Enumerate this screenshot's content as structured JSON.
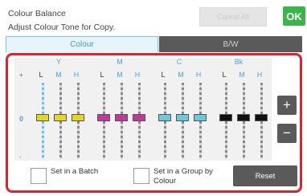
{
  "header": {
    "title": "Colour Balance",
    "subtitle": "Adjust Colour Tone for Copy.",
    "cancel_all_label": "Cancel All",
    "ok_label": "OK"
  },
  "tabs": [
    {
      "label": "Colour",
      "active": true
    },
    {
      "label": "B/W",
      "active": false
    }
  ],
  "scale": {
    "plus": "+",
    "zero": "0",
    "minus": "-"
  },
  "groups": [
    {
      "name": "Y",
      "color": "#e6d521",
      "columns": [
        "L",
        "M",
        "H"
      ],
      "levels": [
        0,
        0,
        0
      ]
    },
    {
      "name": "M",
      "color": "#c0399a",
      "columns": [
        "L",
        "M",
        "H"
      ],
      "levels": [
        0,
        0,
        0
      ]
    },
    {
      "name": "C",
      "color": "#6ac9df",
      "columns": [
        "L",
        "M",
        "H"
      ],
      "levels": [
        0,
        0,
        0
      ]
    },
    {
      "name": "Bk",
      "color": "#111111",
      "columns": [
        "L",
        "M",
        "H"
      ],
      "levels": [
        0,
        0,
        0
      ]
    }
  ],
  "step_buttons": {
    "plus": "+",
    "minus": "−"
  },
  "options": {
    "batch_label": "Set in a Batch",
    "group_label_line1": "Set in a Group by",
    "group_label_line2": "Colour",
    "reset_label": "Reset"
  }
}
